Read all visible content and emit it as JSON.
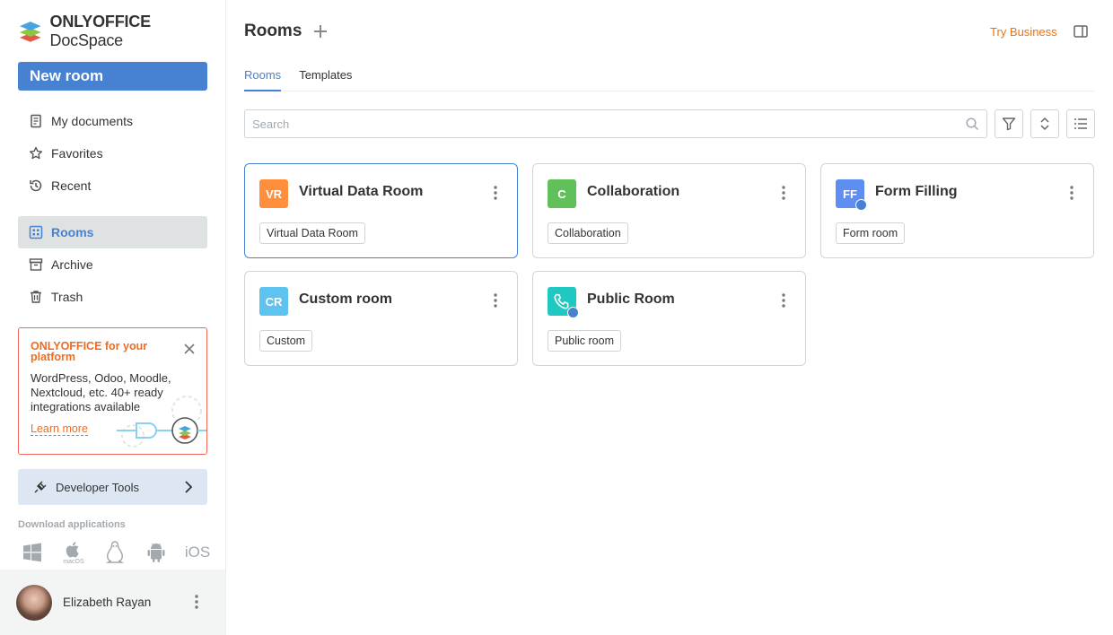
{
  "brand": {
    "logo_bold": "ONLYOFFICE",
    "logo_regular": "DocSpace"
  },
  "sidebar": {
    "new_room_label": "New room",
    "nav_top": [
      {
        "label": "My documents",
        "icon": "document-icon"
      },
      {
        "label": "Favorites",
        "icon": "star-icon"
      },
      {
        "label": "Recent",
        "icon": "history-icon"
      }
    ],
    "nav_bottom": [
      {
        "label": "Rooms",
        "icon": "rooms-grid-icon",
        "active": true
      },
      {
        "label": "Archive",
        "icon": "archive-icon"
      },
      {
        "label": "Trash",
        "icon": "trash-icon"
      }
    ],
    "promo": {
      "title": "ONLYOFFICE for your platform",
      "body": "WordPress, Odoo, Moodle, Nextcloud, etc. 40+ ready integrations available",
      "link": "Learn more"
    },
    "developer_tools": "Developer Tools",
    "download_label": "Download applications",
    "apps": [
      "windows-icon",
      "macos-icon",
      "linux-icon",
      "android-icon",
      "ios-icon"
    ],
    "macos_label": "macOS",
    "ios_label": "iOS",
    "user": {
      "name": "Elizabeth Rayan"
    }
  },
  "header": {
    "title": "Rooms",
    "try_business": "Try Business"
  },
  "tabs": [
    {
      "label": "Rooms",
      "active": true
    },
    {
      "label": "Templates",
      "active": false
    }
  ],
  "search": {
    "placeholder": "Search"
  },
  "rooms": [
    {
      "initials": "VR",
      "title": "Virtual Data Room",
      "tag": "Virtual Data Room",
      "color": "#ff8e3d",
      "selected": true
    },
    {
      "initials": "C",
      "title": "Collaboration",
      "tag": "Collaboration",
      "color": "#61c059"
    },
    {
      "initials": "FF",
      "title": "Form Filling",
      "tag": "Form room",
      "color": "#5e8ef0",
      "public": true
    },
    {
      "initials": "CR",
      "title": "Custom room",
      "tag": "Custom",
      "color": "#5ec3f0"
    },
    {
      "initials": "",
      "title": "Public Room",
      "tag": "Public room",
      "color": "#1fc9c1",
      "icon": "phone-icon",
      "public": true
    }
  ],
  "colors": {
    "accent": "#4781d1",
    "orange": "#ed7309",
    "promo_border": "#f2665a"
  }
}
